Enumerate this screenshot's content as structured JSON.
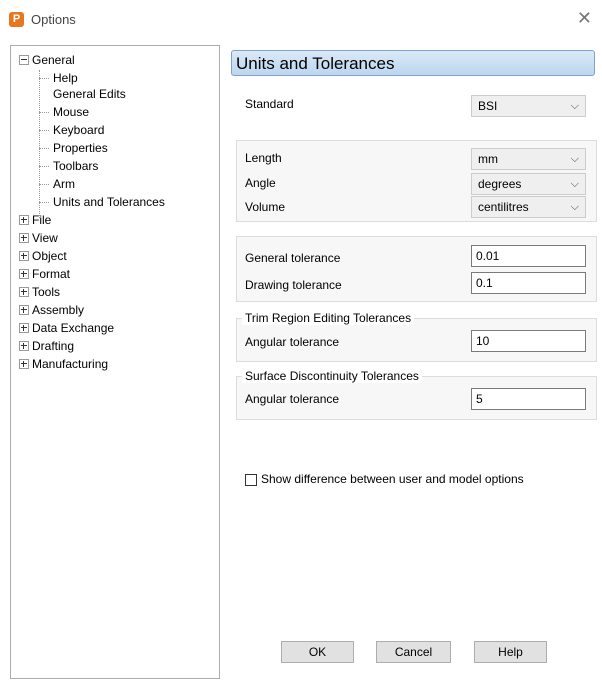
{
  "window": {
    "title": "Options",
    "app_icon_letter": "P"
  },
  "tree": {
    "general": {
      "label": "General",
      "children": [
        "Help",
        "General Edits",
        "Mouse",
        "Keyboard",
        "Properties",
        "Toolbars",
        "Arm",
        "Units and Tolerances"
      ]
    },
    "top_items": [
      "File",
      "View",
      "Object",
      "Format",
      "Tools",
      "Assembly",
      "Data Exchange",
      "Drafting",
      "Manufacturing"
    ],
    "selected": "Units and Tolerances"
  },
  "panel": {
    "title": "Units and Tolerances",
    "standard": {
      "label": "Standard",
      "value": "BSI"
    },
    "units": {
      "length": {
        "label": "Length",
        "value": "mm"
      },
      "angle": {
        "label": "Angle",
        "value": "degrees"
      },
      "volume": {
        "label": "Volume",
        "value": "centilitres"
      }
    },
    "tolerances": {
      "general": {
        "label": "General tolerance",
        "value": "0.01"
      },
      "drawing": {
        "label": "Drawing tolerance",
        "value": "0.1"
      }
    },
    "trim": {
      "title": "Trim Region Editing Tolerances",
      "label": "Angular tolerance",
      "value": "10"
    },
    "surface": {
      "title": "Surface Discontinuity Tolerances",
      "label": "Angular tolerance",
      "value": "5"
    },
    "show_difference": {
      "label": "Show difference between user and model options",
      "checked": false
    }
  },
  "buttons": {
    "ok": "OK",
    "cancel": "Cancel",
    "help": "Help"
  },
  "icons": {
    "close": "close-icon",
    "chevron": "chevron-down-icon",
    "expand": "plus-box-icon",
    "collapse": "minus-box-icon"
  }
}
